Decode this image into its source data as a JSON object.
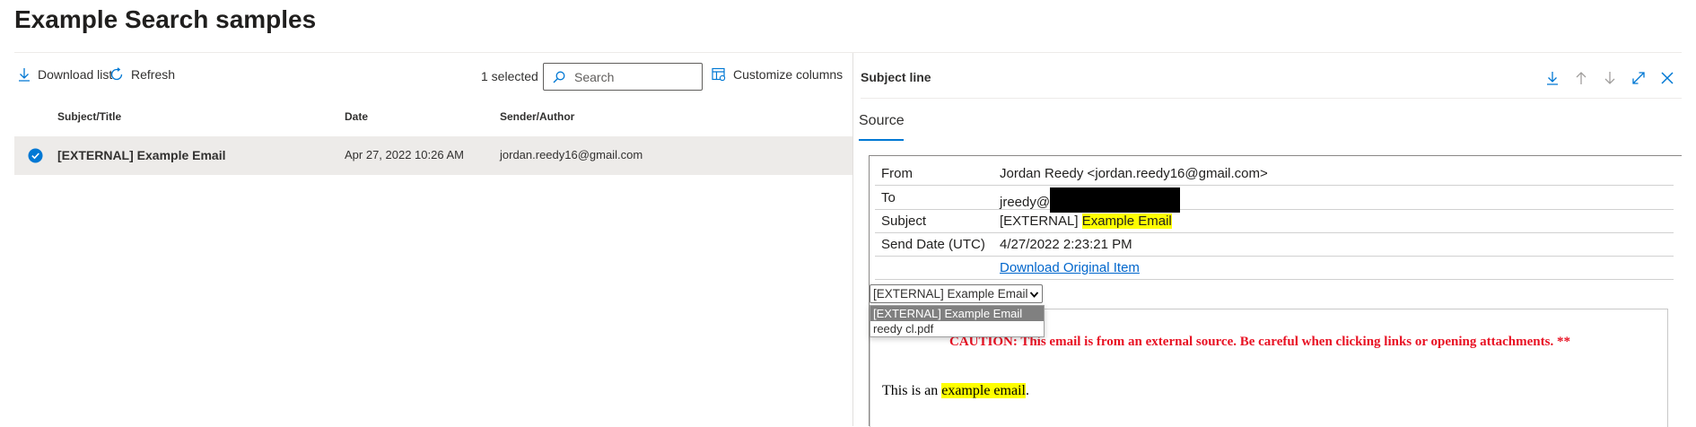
{
  "page": {
    "title": "Example Search samples"
  },
  "toolbar": {
    "download_label": "Download list",
    "refresh_label": "Refresh",
    "selected_count": "1 selected",
    "search_placeholder": "Search",
    "customize_label": "Customize columns"
  },
  "table": {
    "columns": [
      "Subject/Title",
      "Date",
      "Sender/Author"
    ],
    "rows": [
      {
        "subject": "[EXTERNAL] Example Email",
        "date": "Apr 27, 2022 10:26 AM",
        "sender": "jordan.reedy16@gmail.com",
        "selected": true
      }
    ]
  },
  "detail": {
    "title": "Subject line",
    "tab": "Source",
    "headers": {
      "from_label": "From",
      "from_value": "Jordan Reedy <jordan.reedy16@gmail.com>",
      "to_label": "To",
      "to_value": "jreedy@",
      "subject_label": "Subject",
      "subject_prefix": "[EXTERNAL] ",
      "subject_highlight": "Example Email",
      "date_label": "Send Date (UTC)",
      "date_value": "4/27/2022 2:23:21 PM",
      "download_link": "Download Original Item"
    },
    "attachment_select": {
      "value": "[EXTERNAL] Example Email",
      "options": [
        "[EXTERNAL] Example Email",
        "reedy cl.pdf"
      ]
    },
    "body": {
      "caution": "CAUTION: This email is from an external source. Be careful when clicking links or opening attachments. **",
      "text_prefix": "This is an ",
      "text_highlight": "example email",
      "text_suffix": "."
    }
  },
  "colors": {
    "accent": "#0078d4",
    "highlight": "#ffff00",
    "caution": "#e81123",
    "selected_row": "#edebe9"
  }
}
